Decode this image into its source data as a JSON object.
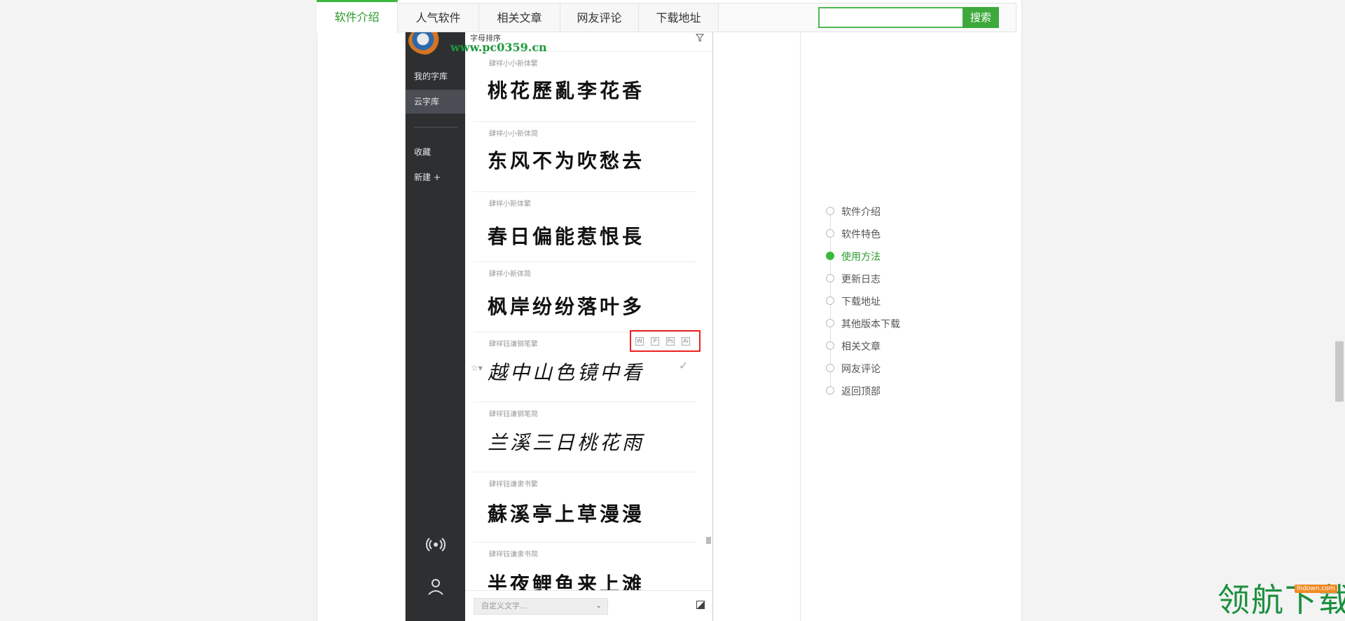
{
  "tabs": [
    "软件介绍",
    "人气软件",
    "相关文章",
    "网友评论",
    "下载地址"
  ],
  "search": {
    "button_label": "搜索",
    "value": ""
  },
  "app": {
    "watermark_url": "www.pc0359.cn",
    "list_header": "字母排序",
    "side_items": [
      "我的字库",
      "云字库",
      "收藏",
      "新建 +"
    ],
    "fonts": [
      {
        "name": "肆祥小小新体繁",
        "sample": "桃花歷亂李花香"
      },
      {
        "name": "肆祥小小新体简",
        "sample": "东风不为吹愁去"
      },
      {
        "name": "肆祥小新体繁",
        "sample": "春日偏能惹恨長"
      },
      {
        "name": "肆祥小新体简",
        "sample": "枫岸纷纷落叶多"
      },
      {
        "name": "肆祥钰谦钢笔繁",
        "sample": "越中山色镜中看"
      },
      {
        "name": "肆祥钰谦钢笔简",
        "sample": "兰溪三日桃花雨"
      },
      {
        "name": "肆祥钰谦隶书繁",
        "sample": "蘇溪亭上草漫漫"
      },
      {
        "name": "肆祥钰谦隶书简",
        "sample": "半夜鲤鱼来上滩"
      }
    ],
    "format_badges": [
      "W",
      "P",
      "Ps",
      "Ai"
    ],
    "custom_text_placeholder": "自定义文字...",
    "icons": {
      "broadcast": "broadcast-icon",
      "user": "user-icon",
      "filter": "filter-icon",
      "check": "check-icon",
      "star": "star-icon"
    }
  },
  "toc": {
    "items": [
      "软件介绍",
      "软件特色",
      "使用方法",
      "更新日志",
      "下载地址",
      "其他版本下载",
      "相关文章",
      "网友评论",
      "返回顶部"
    ],
    "active": "使用方法"
  },
  "brand": {
    "name": "领航下载",
    "url": "lhdown.com"
  },
  "colors": {
    "accent": "#3cb93c",
    "highlight_box": "#e8231f",
    "sidebar": "#2d2f31"
  }
}
